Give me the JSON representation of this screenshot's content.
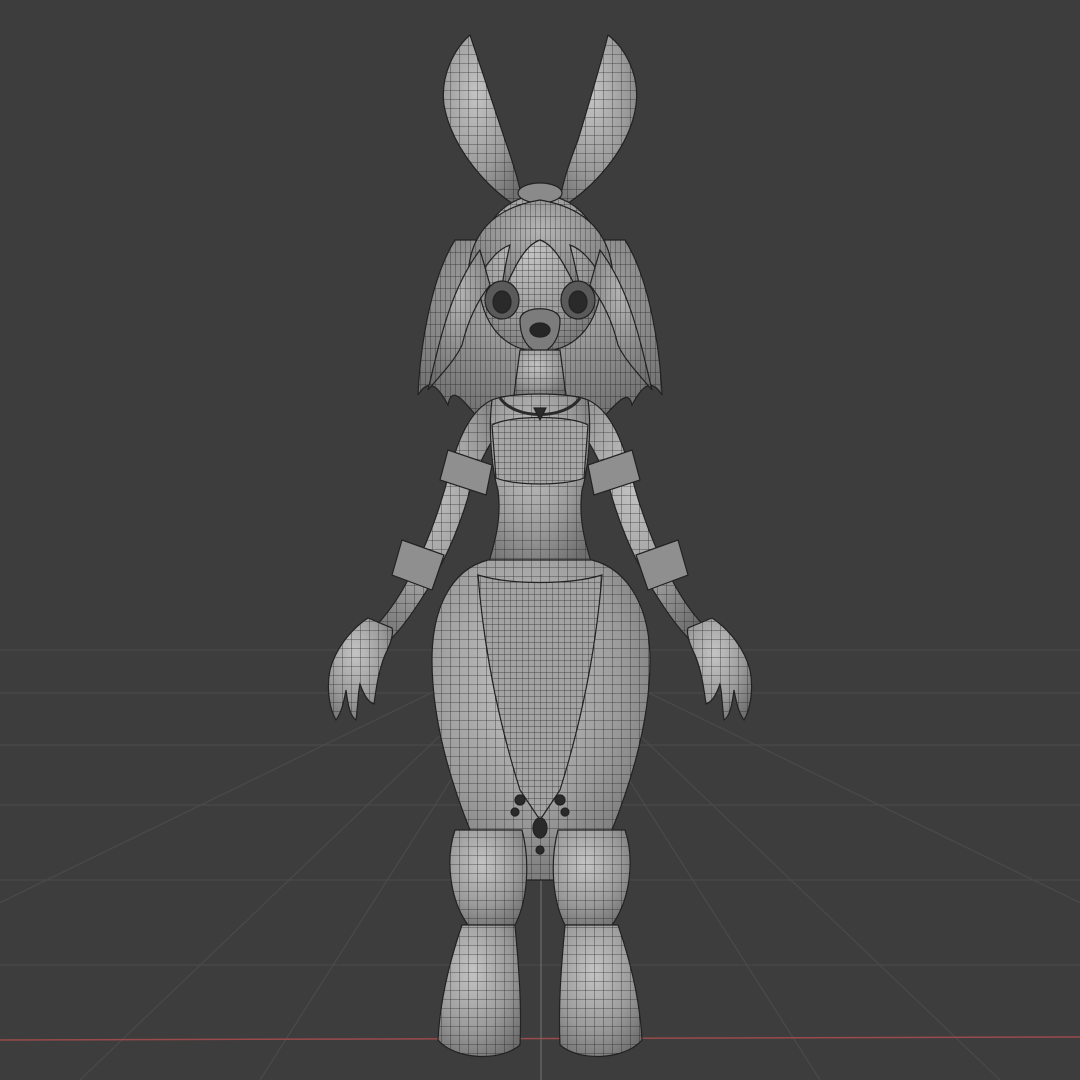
{
  "viewport": {
    "background_color": "#3d3d3d",
    "grid_line_color": "#4a4a4a",
    "x_axis_color": "#9a4a4a",
    "y_axis_color": "#6b6b6b"
  },
  "model": {
    "base_color": "#9b9b9b",
    "shadow_color": "#6f6f6f",
    "highlight_color": "#c4c4c4",
    "wire_color": "#1e1e1e",
    "ornament_color": "#2a2a2a"
  }
}
